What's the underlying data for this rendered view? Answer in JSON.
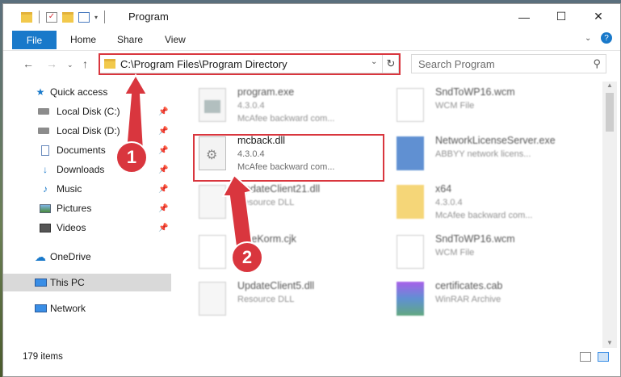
{
  "window": {
    "title": "Program",
    "controls": {
      "minimize": "—",
      "maximize": "☐",
      "close": "✕"
    }
  },
  "ribbon": {
    "tabs": [
      "File",
      "Home",
      "Share",
      "View"
    ],
    "help": "?"
  },
  "address": {
    "path": "C:\\Program Files\\Program Directory",
    "search_placeholder": "Search Program"
  },
  "nav": {
    "items": [
      {
        "label": "Quick access",
        "icon": "star-icon",
        "pinned": false
      },
      {
        "label": "Local Disk (C:)",
        "icon": "drive-icon",
        "pinned": true
      },
      {
        "label": "Local Disk (D:)",
        "icon": "drive-icon",
        "pinned": true
      },
      {
        "label": "Documents",
        "icon": "documents-icon",
        "pinned": true
      },
      {
        "label": "Downloads",
        "icon": "download-icon",
        "pinned": true
      },
      {
        "label": "Music",
        "icon": "music-icon",
        "pinned": true
      },
      {
        "label": "Pictures",
        "icon": "pictures-icon",
        "pinned": true
      },
      {
        "label": "Videos",
        "icon": "videos-icon",
        "pinned": true
      },
      {
        "label": "OneDrive",
        "icon": "cloud-icon",
        "pinned": false
      },
      {
        "label": "This PC",
        "icon": "computer-icon",
        "pinned": false,
        "selected": true
      },
      {
        "label": "Network",
        "icon": "network-icon",
        "pinned": false
      }
    ]
  },
  "files": [
    {
      "name": "program.exe",
      "version": "4.3.0.4",
      "desc": "McAfee backward com..."
    },
    {
      "name": "SndToWP16.wcm",
      "version": "WCM File",
      "desc": ""
    },
    {
      "name": "mcback.dll",
      "version": "4.3.0.4",
      "desc": "McAfee backward com..."
    },
    {
      "name": "NetworkLicenseServer.exe",
      "version": "ABBYY network licens...",
      "desc": ""
    },
    {
      "name": "UpdateClient21.dll",
      "version": "Resource DLL",
      "desc": ""
    },
    {
      "name": "x64",
      "version": "4.3.0.4",
      "desc": "McAfee backward com..."
    },
    {
      "name": "FineKorm.cjk",
      "version": "",
      "desc": ""
    },
    {
      "name": "SndToWP16.wcm",
      "version": "WCM File",
      "desc": ""
    },
    {
      "name": "UpdateClient5.dll",
      "version": "Resource DLL",
      "desc": ""
    },
    {
      "name": "certificates.cab",
      "version": "WinRAR Archive",
      "desc": ""
    }
  ],
  "status": {
    "items_count": "179 items"
  },
  "annotations": {
    "step1": "1",
    "step2": "2"
  },
  "colors": {
    "accent": "#1979ca",
    "highlight": "#d9363e"
  }
}
